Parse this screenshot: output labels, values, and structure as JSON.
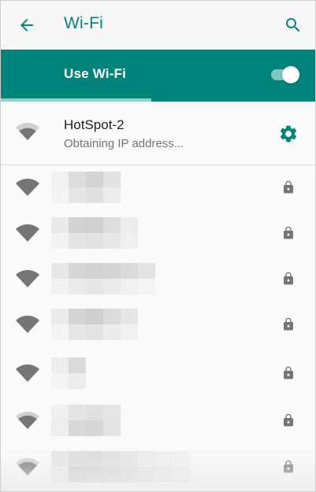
{
  "header": {
    "title": "Wi-Fi",
    "back_icon": "arrow-left-icon",
    "search_icon": "search-icon"
  },
  "master_switch": {
    "label": "Use Wi-Fi",
    "enabled": true,
    "scan_progress": 0.48
  },
  "current_network": {
    "name": "HotSpot-2",
    "status": "Obtaining IP address...",
    "signal_icon": "wifi-signal-icon",
    "settings_icon": "gear-icon"
  },
  "networks": [
    {
      "signal": 4,
      "secured": true,
      "name_hidden": true
    },
    {
      "signal": 4,
      "secured": true,
      "name_hidden": true
    },
    {
      "signal": 4,
      "secured": true,
      "name_hidden": true
    },
    {
      "signal": 4,
      "secured": true,
      "name_hidden": true
    },
    {
      "signal": 4,
      "secured": true,
      "name_hidden": true
    },
    {
      "signal": 3,
      "secured": true,
      "name_hidden": true
    },
    {
      "signal": 3,
      "secured": true,
      "name_hidden": true
    }
  ],
  "colors": {
    "accent": "#00837b",
    "track": "#7fc7c1",
    "primary_text": "#212121",
    "secondary_text": "#737373",
    "icon_gray": "#757575"
  }
}
